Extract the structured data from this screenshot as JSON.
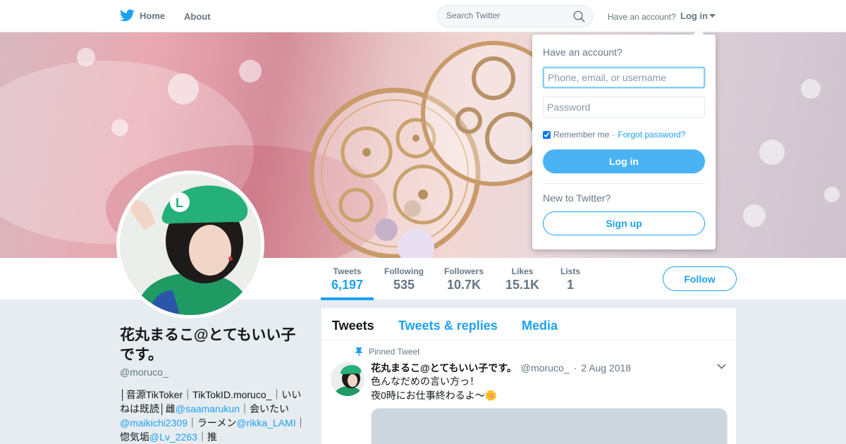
{
  "colors": {
    "brand": "#1da1f2",
    "background": "#e6ecf0",
    "text": "#14171a",
    "muted": "#657786"
  },
  "topbar": {
    "home_label": "Home",
    "about_label": "About",
    "search_placeholder": "Search Twitter",
    "have_account_label": "Have an account?",
    "login_label": "Log in",
    "icons": [
      "twitter-bird-icon",
      "search-icon",
      "caret-down-icon"
    ]
  },
  "profile_nav": {
    "stats": [
      {
        "label": "Tweets",
        "value": "6,197",
        "active": true
      },
      {
        "label": "Following",
        "value": "535"
      },
      {
        "label": "Followers",
        "value": "10.7K"
      },
      {
        "label": "Likes",
        "value": "15.1K"
      },
      {
        "label": "Lists",
        "value": "1"
      }
    ],
    "follow_label": "Follow"
  },
  "profile": {
    "name": "花丸まるこ@とてもいい子です。",
    "handle": "@moruco_",
    "bio": {
      "t1": "│音源TikToker｜TikTokID.moruco_｜いいねは既読│雌",
      "m1": "@saamarukun",
      "t2": "｜会いたい",
      "m2": "@maikichi2309",
      "t3": "｜ラーメン",
      "m3": "@rikka_LAMI",
      "t4": "｜惚気垢",
      "m4": "@Lv_2263",
      "t5": "｜推"
    }
  },
  "timeline": {
    "tabs": [
      "Tweets",
      "Tweets & replies",
      "Media"
    ],
    "pinned_label": "Pinned Tweet",
    "tweet": {
      "name": "花丸まるこ@とてもいい子です。",
      "handle": "@moruco_",
      "separator": "·",
      "date": "2 Aug 2018",
      "line1": "色んなだめの言い方っ！",
      "line2": "夜0時にお仕事終わるよ〜",
      "emoji": "🌼"
    }
  },
  "login_dropdown": {
    "title": "Have an account?",
    "username_placeholder": "Phone, email, or username",
    "password_placeholder": "Password",
    "remember_label": "Remember me",
    "separator": "·",
    "forgot_label": "Forgot password?",
    "remember_checked": true,
    "login_button": "Log in",
    "new_label": "New to Twitter?",
    "signup_button": "Sign up"
  }
}
